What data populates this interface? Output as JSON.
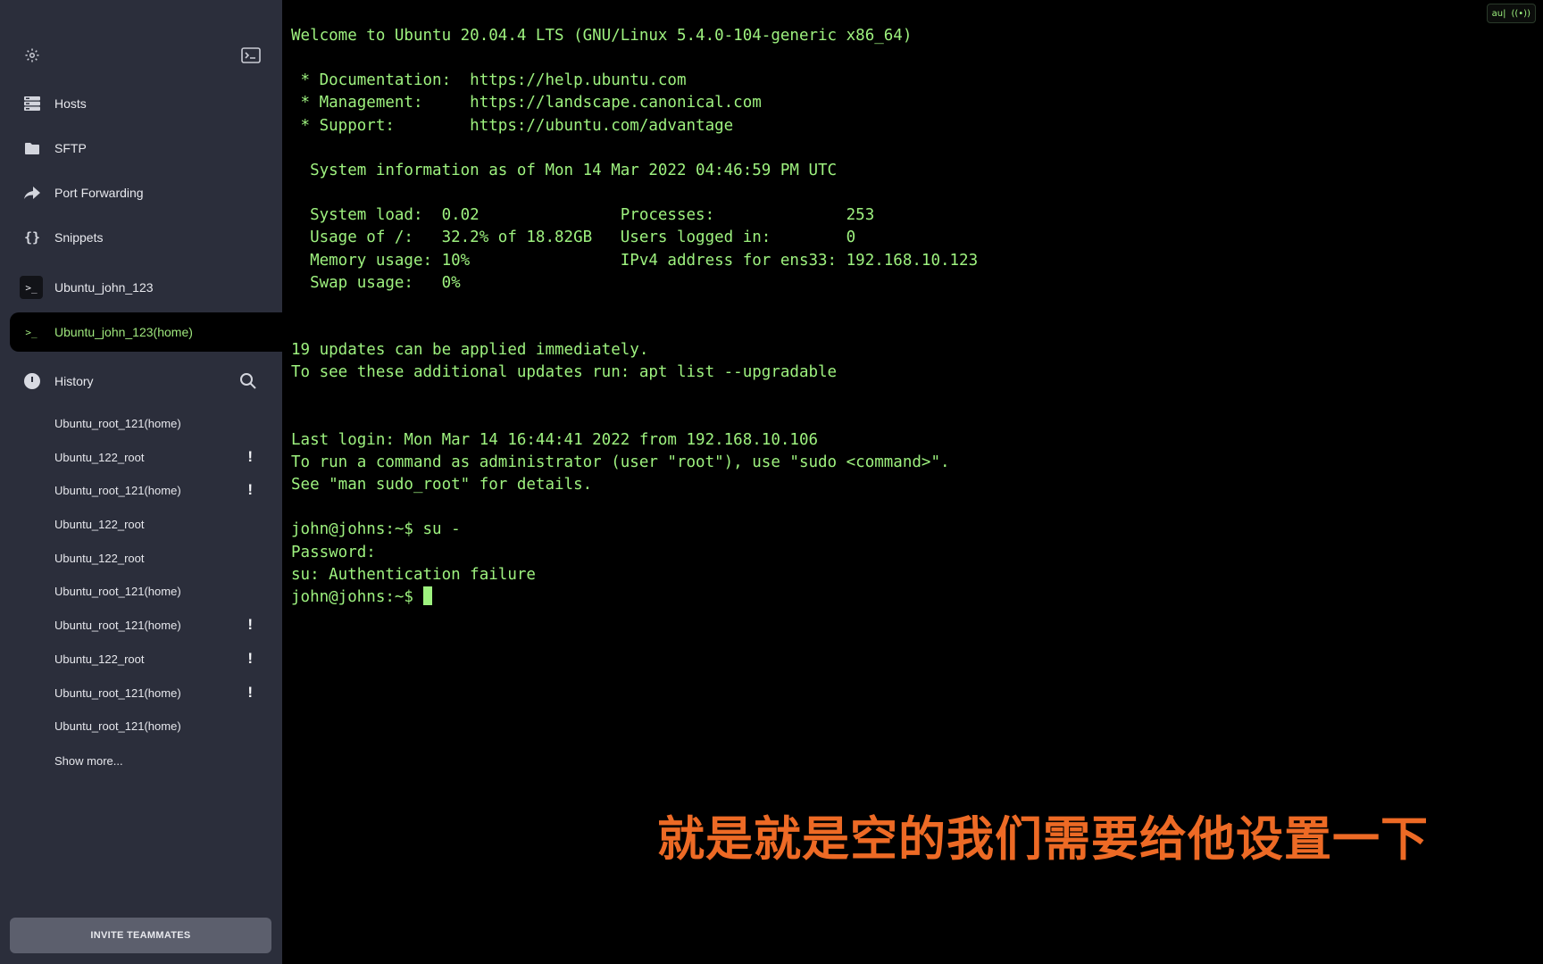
{
  "sidebar": {
    "nav": [
      {
        "label": "Hosts",
        "icon": "hosts-icon"
      },
      {
        "label": "SFTP",
        "icon": "folder-icon"
      },
      {
        "label": "Port Forwarding",
        "icon": "port-forwarding-icon"
      },
      {
        "label": "Snippets",
        "icon": "snippets-icon"
      }
    ],
    "host_tabs": [
      {
        "label": "Ubuntu_john_123",
        "active": false
      },
      {
        "label": "Ubuntu_john_123(home)",
        "active": true
      }
    ],
    "history": {
      "title": "History",
      "items": [
        {
          "label": "Ubuntu_root_121(home)",
          "alert": ""
        },
        {
          "label": "Ubuntu_122_root",
          "alert": "!"
        },
        {
          "label": "Ubuntu_root_121(home)",
          "alert": "!"
        },
        {
          "label": "Ubuntu_122_root",
          "alert": ""
        },
        {
          "label": "Ubuntu_122_root",
          "alert": ""
        },
        {
          "label": "Ubuntu_root_121(home)",
          "alert": ""
        },
        {
          "label": "Ubuntu_root_121(home)",
          "alert": "!"
        },
        {
          "label": "Ubuntu_122_root",
          "alert": "!"
        },
        {
          "label": "Ubuntu_root_121(home)",
          "alert": "!"
        },
        {
          "label": "Ubuntu_root_121(home)",
          "alert": ""
        }
      ],
      "show_more": "Show more..."
    },
    "invite_label": "INVITE TEAMMATES"
  },
  "terminal": {
    "lines": [
      "Welcome to Ubuntu 20.04.4 LTS (GNU/Linux 5.4.0-104-generic x86_64)",
      "",
      " * Documentation:  https://help.ubuntu.com",
      " * Management:     https://landscape.canonical.com",
      " * Support:        https://ubuntu.com/advantage",
      "",
      "  System information as of Mon 14 Mar 2022 04:46:59 PM UTC",
      "",
      "  System load:  0.02               Processes:              253",
      "  Usage of /:   32.2% of 18.82GB   Users logged in:        0",
      "  Memory usage: 10%                IPv4 address for ens33: 192.168.10.123",
      "  Swap usage:   0%",
      "",
      "",
      "19 updates can be applied immediately.",
      "To see these additional updates run: apt list --upgradable",
      "",
      "",
      "Last login: Mon Mar 14 16:44:41 2022 from 192.168.10.106",
      "To run a command as administrator (user \"root\"), use \"sudo <command>\".",
      "See \"man sudo_root\" for details.",
      "",
      "john@johns:~$ su -",
      "Password:",
      "su: Authentication failure"
    ],
    "prompt": "john@johns:~$ ",
    "status_badge": {
      "left": "au|",
      "right": "((•))"
    }
  },
  "subtitle": "就是就是空的我们需要给他设置一下",
  "colors": {
    "sidebar_bg": "#2b2e3b",
    "terminal_fg": "#9ef27f",
    "subtitle": "#ed6a25",
    "invite_bg": "#5c5f6d"
  }
}
